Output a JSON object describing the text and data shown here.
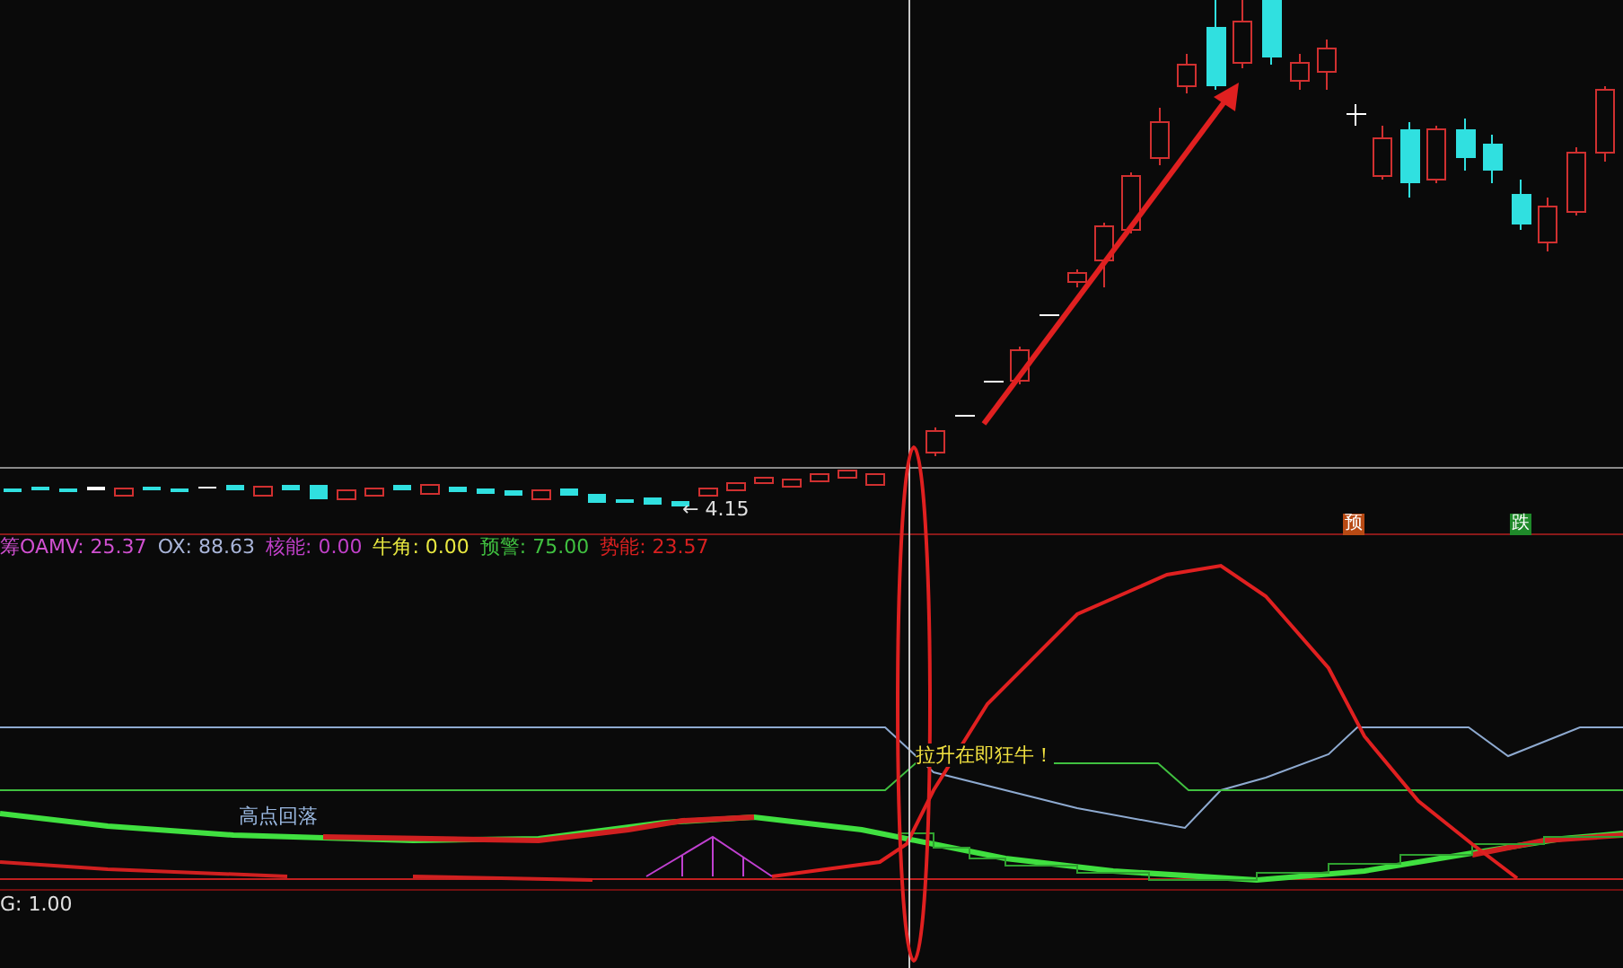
{
  "price_panel": {
    "low_marker": "← 4.15",
    "signals": [
      {
        "text": "预",
        "color": "#b84a14"
      },
      {
        "text": "跌",
        "color": "#1f8a2a"
      }
    ]
  },
  "indicator_header": [
    {
      "text": "筹OAMV: 25.37",
      "color": "#d050d0"
    },
    {
      "text": "OX: 88.63",
      "color": "#a8b4d8"
    },
    {
      "text": "核能: 0.00",
      "color": "#c040c8"
    },
    {
      "text": "牛角: 0.00",
      "color": "#e8e840"
    },
    {
      "text": "预警: 75.00",
      "color": "#40c040"
    },
    {
      "text": "势能: 23.57",
      "color": "#d82020"
    }
  ],
  "annotations": [
    {
      "text": "高点回落",
      "color": "#9ab8e0"
    },
    {
      "text": "拉升在即狂牛！",
      "color": "#f0e040"
    }
  ],
  "bottom_readout": "G: 1.00"
}
